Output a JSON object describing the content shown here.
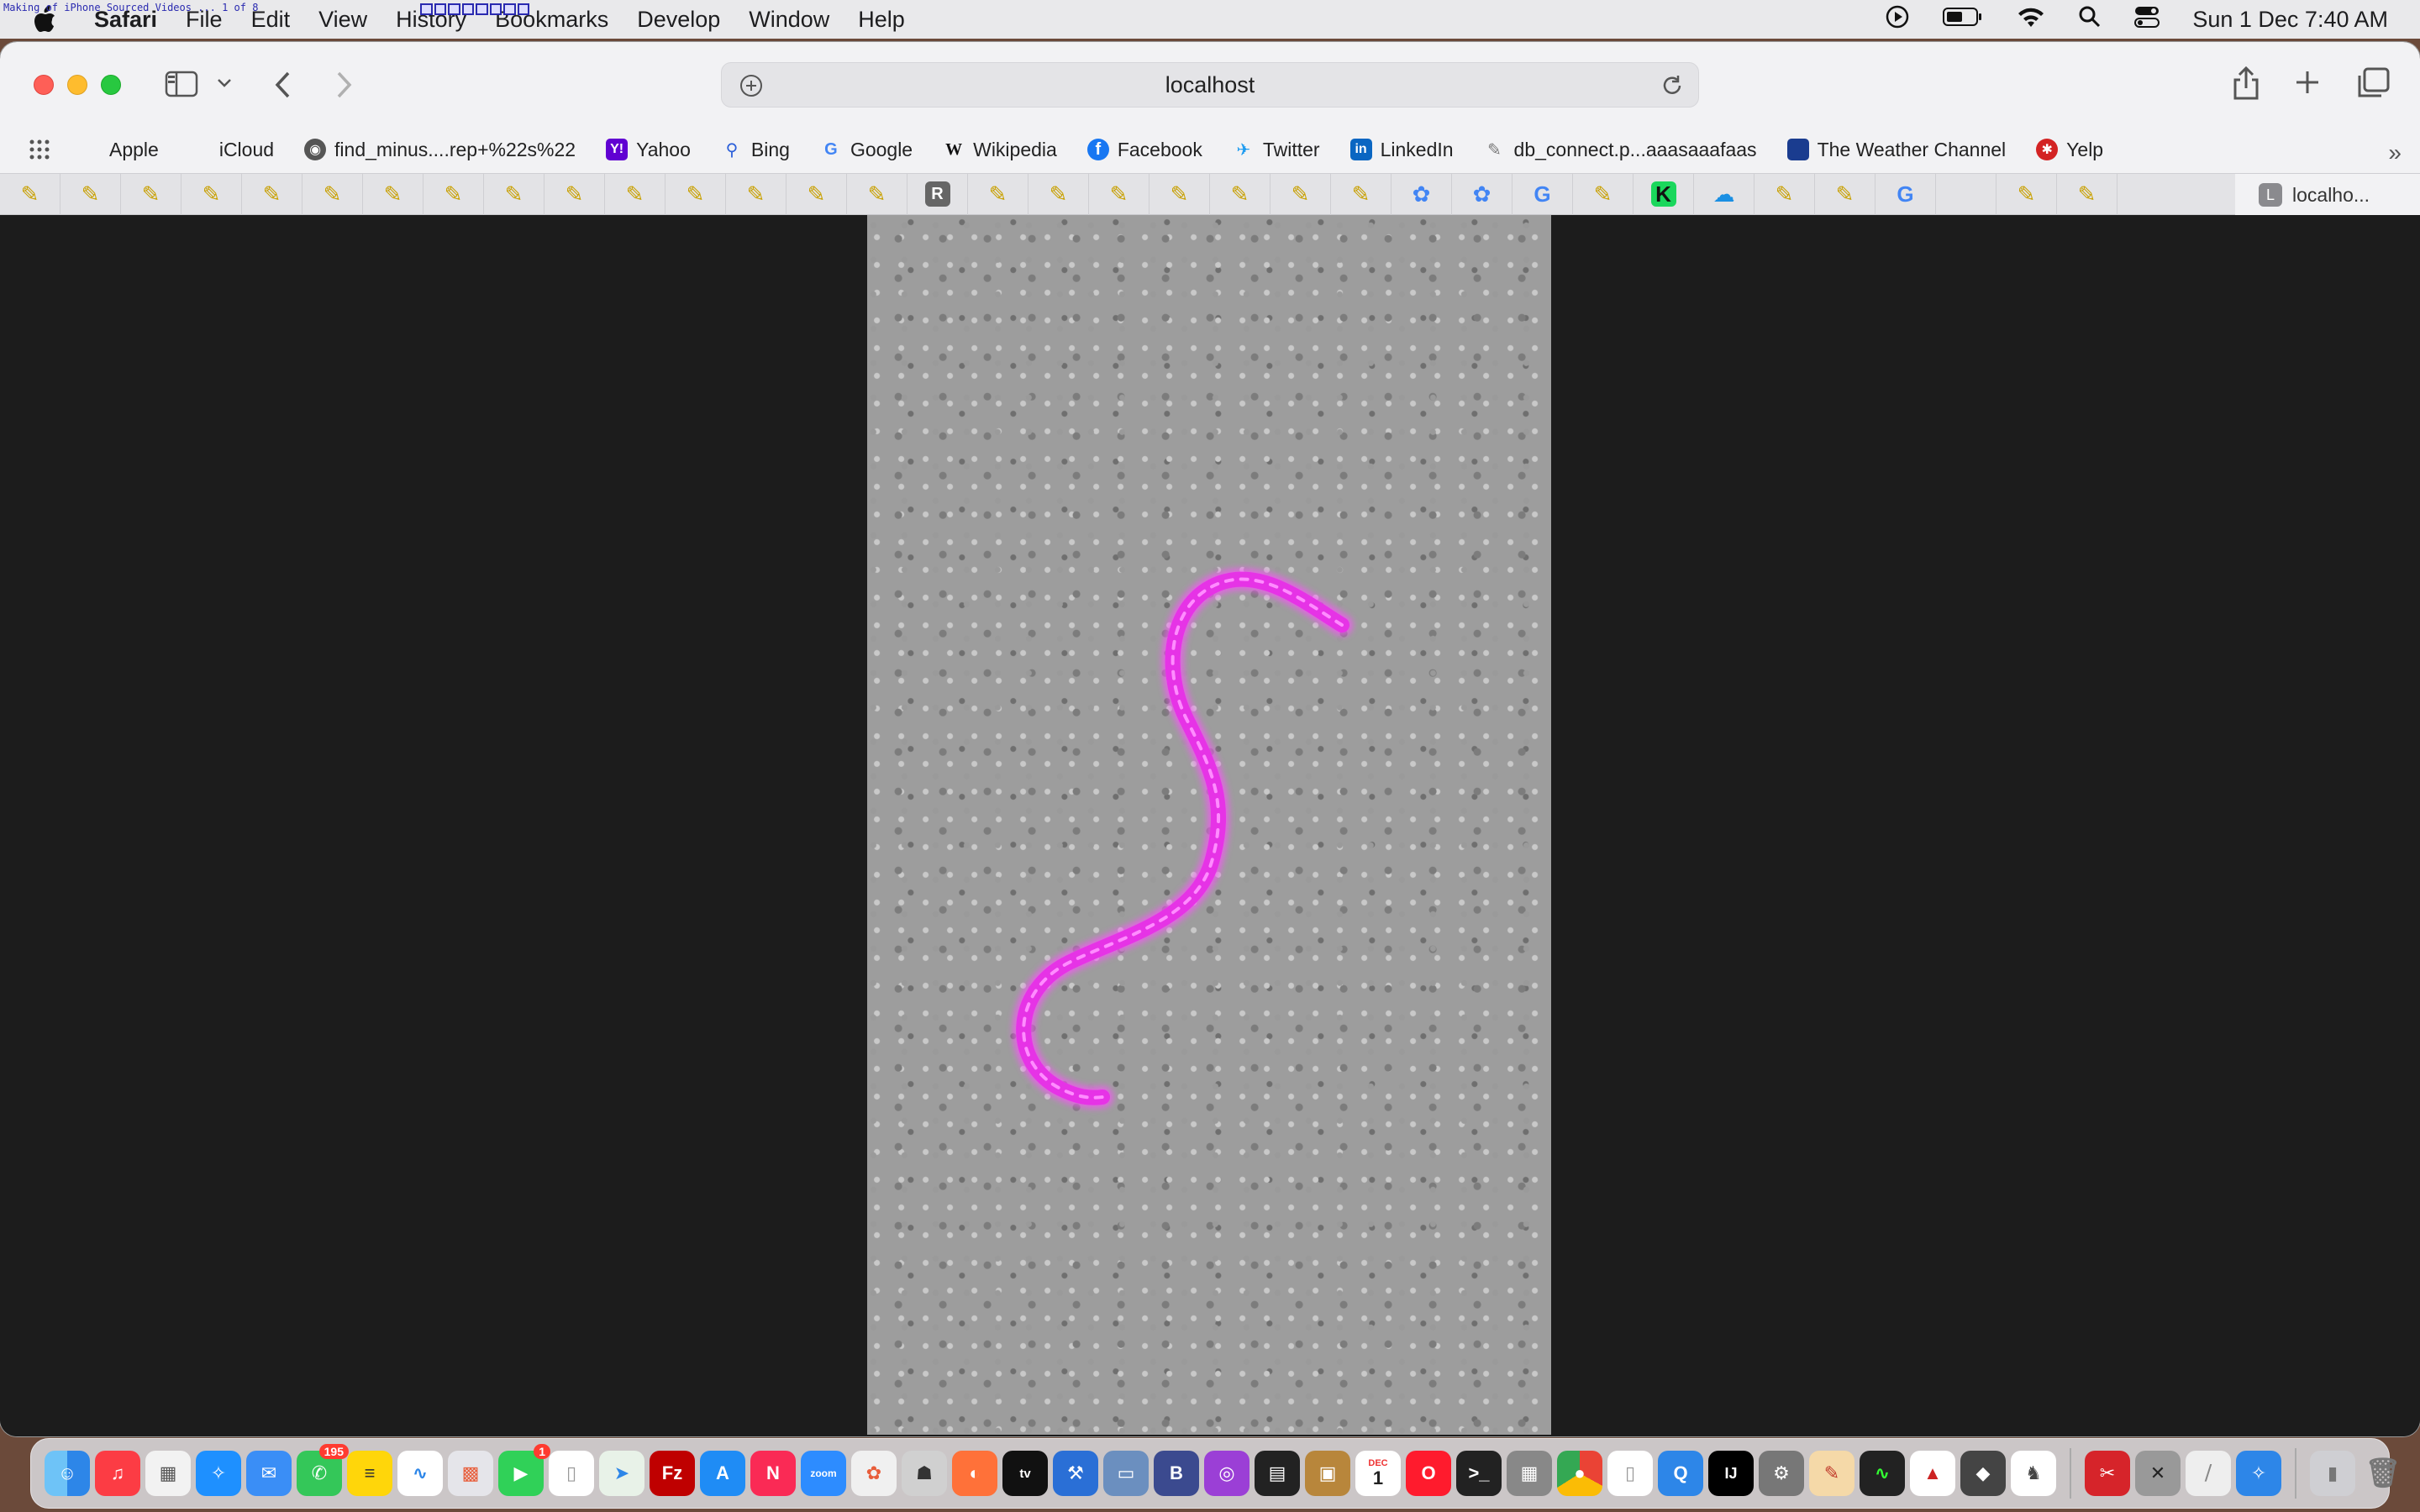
{
  "menubar": {
    "app_name": "Safari",
    "menus": [
      "File",
      "Edit",
      "View",
      "History",
      "Bookmarks",
      "Develop",
      "Window",
      "Help"
    ],
    "overlay_text": "Making of iPhone Sourced Videos ... 1 of 8",
    "clock": "Sun 1 Dec  7:40 AM"
  },
  "browser": {
    "url": "localhost",
    "favorites": [
      {
        "label": "Apple",
        "icon": "apple-icon"
      },
      {
        "label": "iCloud",
        "icon": "apple-icon"
      },
      {
        "label": "find_minus....rep+%22s%22",
        "icon": "github-icon"
      },
      {
        "label": "Yahoo",
        "icon": "yahoo-icon"
      },
      {
        "label": "Bing",
        "icon": "search-icon"
      },
      {
        "label": "Google",
        "icon": "google-icon"
      },
      {
        "label": "Wikipedia",
        "icon": "wikipedia-icon"
      },
      {
        "label": "Facebook",
        "icon": "facebook-icon"
      },
      {
        "label": "Twitter",
        "icon": "twitter-icon"
      },
      {
        "label": "LinkedIn",
        "icon": "linkedin-icon"
      },
      {
        "label": "db_connect.p...aaasaaafaas",
        "icon": "pen-icon"
      },
      {
        "label": "The Weather Channel",
        "icon": "weather-icon"
      },
      {
        "label": "Yelp",
        "icon": "yelp-icon"
      }
    ],
    "pinned_tab_glyphs": [
      "✎",
      "✎",
      "✎",
      "✎",
      "✎",
      "✎",
      "✎",
      "✎",
      "✎",
      "✎",
      "✎",
      "✎",
      "✎",
      "✎",
      "✎",
      "R",
      "✎",
      "✎",
      "✎",
      "✎",
      "✎",
      "✎",
      "✎",
      "✿",
      "✿",
      "G",
      "✎",
      "K",
      "☁",
      "✎",
      "✎",
      "G",
      "",
      "✎",
      "✎"
    ],
    "active_tab": {
      "badge": "L",
      "label": "localho..."
    }
  },
  "dock": {
    "messages_badge": "195",
    "facetime_badge": "1",
    "calendar_month": "DEC",
    "calendar_day": "1",
    "zoom_label": "zoom"
  }
}
